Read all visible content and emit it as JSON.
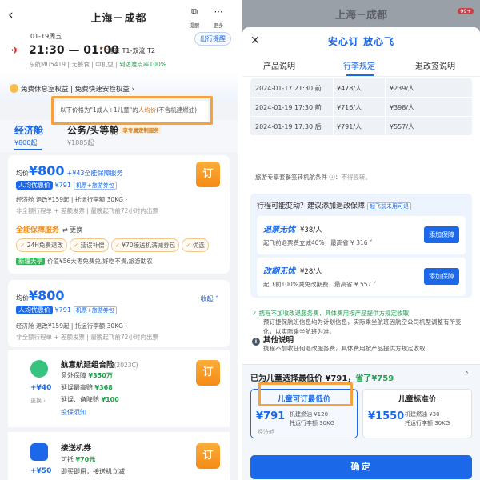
{
  "left": {
    "header": {
      "title": "上海－成都",
      "icon1_label": "提醒",
      "icon2_label": "更多"
    },
    "flight": {
      "date": "01-19周五",
      "alert_button": "出行提醒",
      "times": "21:30 — 01:00",
      "plus_day": "+1",
      "route": "浦东 T1-双流 T2",
      "sub_info": "东航MU5419 | 无餐食 | 中机型 | ",
      "on_time": "到达准点率100%",
      "airline_logo": "china-eastern-logo"
    },
    "perks": "免费休息室权益 | 免费快速安检权益 ›",
    "notice": {
      "prefix": "以下价格为\"1成人+1儿童\"的",
      "highlight": "人均价",
      "suffix": "(不含机建燃油)"
    },
    "tabs": [
      {
        "label": "经济舱",
        "price": "¥800起"
      },
      {
        "label": "公务/头等舱",
        "price": "¥1885起",
        "badge": "享专属定制服务"
      }
    ],
    "fare1": {
      "avg_label": "均价",
      "price": "¥800",
      "service": "+¥43全能保障服务",
      "discount_label": "人均优惠价",
      "discount_price": "¥791",
      "discount_tag": "机票+旅游券包",
      "rules": "经济舱  退改¥159起 | 托运行李额 30KG ›",
      "extra": "非全额行程单 + 差额发票 | 最晚起飞前72小时内出票",
      "book": "订",
      "guarantee_title": "全能保障服务",
      "guarantee_switch": "⇄ 更换",
      "chips": [
        "24H免费退改",
        "延误补偿",
        "¥70接送机满减券包",
        "优选"
      ],
      "newuser_tag": "新疆大亭",
      "newuser_text": "价值¥56大枣免费兑,好吃不贵,旅游助农"
    },
    "fare2": {
      "avg_label": "均价",
      "price": "¥800",
      "discount_label": "人均优惠价",
      "discount_price": "¥791",
      "discount_tag": "机票+旅游券包",
      "collapse": "收起 ˄",
      "rules": "经济舱  退改¥159起 | 托运行李额 30KG ›",
      "extra": "非全额行程单 + 差额发票 | 最晚起飞前72小时内出票"
    },
    "insurance": [
      {
        "title": "航意航延组合险",
        "year": "(2023C)",
        "price": "+¥40",
        "more": "更换 ›",
        "book": "订",
        "lines": [
          {
            "text": "意外保障 ",
            "val": "¥350万"
          },
          {
            "text": "延误最高赔 ",
            "val": "¥368"
          },
          {
            "text": "延误、备降赔 ",
            "val": "¥100"
          }
        ],
        "link": "投保须知"
      },
      {
        "title": "接送机券",
        "price": "+¥50",
        "book": "订",
        "lines": [
          {
            "text": "可抵 ",
            "val": "¥70元"
          },
          {
            "text": "即买即用，接送机立减",
            "val": ""
          }
        ]
      }
    ]
  },
  "right": {
    "bg_title": "上海－成都",
    "bg_badge": "99+",
    "brand": "安心订 放心飞",
    "tabs": [
      "产品说明",
      "行李规定",
      "退改签说明"
    ],
    "table": [
      {
        "time": "2024-01-17 21:30 前",
        "a": "¥478/人",
        "b": "¥239/人"
      },
      {
        "time": "2024-01-19 17:30 前",
        "a": "¥716/人",
        "b": "¥398/人"
      },
      {
        "time": "2024-01-19 17:30 后",
        "a": "¥791/人",
        "b": "¥557/人"
      }
    ],
    "note_label": "旅游专享套餐签转机航条件 ⓘ：",
    "note_value": "不得签转。",
    "change": {
      "head": "行程可能变动？建议添加退改保障",
      "tag": "起飞前未用可退",
      "items": [
        {
          "name": "退票无忧",
          "price": "¥38/人",
          "desc": "起飞前退票费立减40%，最高省 ¥ 316 ˅",
          "btn": "添加保障"
        },
        {
          "name": "改期无忧",
          "price": "¥28/人",
          "desc": "起飞前100%减免改期费，最高省 ¥ 557 ˅",
          "btn": "添加保障"
        }
      ]
    },
    "hint": "✓ 携程不加收改退服务费，具体费用按产品提供方规定收取",
    "other": {
      "title": "其他说明",
      "p1": "预订捷保航班信息均为计划信息，实际乘坐航班因航空公司机型调整有所变化，以实际乘坐航班为准。",
      "p2": "携程不加收任何退改服务费，具体费用按产品提供方规定收取"
    },
    "bottom": {
      "title_prefix": "已为儿童选择最低价 ¥791，",
      "title_save": "省了¥759",
      "options": [
        {
          "label": "儿童可订最低价",
          "price": "¥791",
          "l1": "机建燃油 ¥120",
          "l2": "托运行李额 30KG",
          "note": "经济舱"
        },
        {
          "label": "儿童标准价",
          "price": "¥1550",
          "l1": "机建燃油 ¥30",
          "l2": "托运行李额 30KG"
        }
      ],
      "confirm": "确定"
    }
  },
  "colors": {
    "brand_blue": "#1b69e8",
    "orange": "#f5a13d",
    "green": "#1aa34a"
  }
}
